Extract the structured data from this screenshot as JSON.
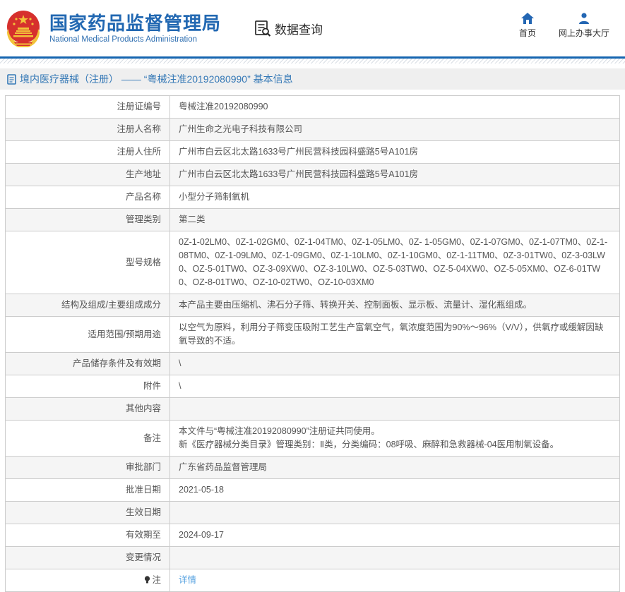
{
  "header": {
    "brand_title": "国家药品监督管理局",
    "brand_subtitle": "National Medical Products Administration",
    "data_query_label": "数据查询",
    "nav": [
      {
        "label": "首页",
        "icon": "home-icon"
      },
      {
        "label": "网上办事大厅",
        "icon": "user-icon"
      }
    ]
  },
  "colors": {
    "brand_blue": "#2268b2",
    "rule_blue": "#1565b0",
    "title_blue": "#3478b6",
    "link_blue": "#55a1e0",
    "emblem_red": "#d6302d",
    "emblem_gold": "#f2c239",
    "row_stripe": "#f5f5f5",
    "border_gray": "#cccccc"
  },
  "page_title": "境内医疗器械（注册） —— “粤械注准20192080990” 基本信息",
  "table": {
    "rows": [
      {
        "label": "注册证编号",
        "value": "粤械注准20192080990"
      },
      {
        "label": "注册人名称",
        "value": "广州生命之光电子科技有限公司"
      },
      {
        "label": "注册人住所",
        "value": "广州市白云区北太路1633号广州民营科技园科盛路5号A101房"
      },
      {
        "label": "生产地址",
        "value": "广州市白云区北太路1633号广州民营科技园科盛路5号A101房"
      },
      {
        "label": "产品名称",
        "value": "小型分子筛制氧机"
      },
      {
        "label": "管理类别",
        "value": "第二类"
      },
      {
        "label": "型号规格",
        "value": "0Z-1-02LM0、0Z-1-02GM0、0Z-1-04TM0、0Z-1-05LM0、0Z- 1-05GM0、0Z-1-07GM0、0Z-1-07TM0、0Z-1-08TM0、0Z-1-09LM0、0Z-1-09GM0、0Z-1-10LM0、0Z-1-10GM0、0Z-1-11TM0、0Z-3-01TW0、0Z-3-03LW0、OZ-5-01TW0、OZ-3-09XW0、OZ-3-10LW0、OZ-5-03TW0、OZ-5-04XW0、OZ-5-05XM0、OZ-6-01TW0、OZ-8-01TW0、OZ-10-02TW0、OZ-10-03XM0"
      },
      {
        "label": "结构及组成/主要组成成分",
        "value": "本产品主要由压缩机、沸石分子筛、转换开关、控制面板、显示板、流量计、湿化瓶组成。"
      },
      {
        "label": "适用范围/预期用途",
        "value": "以空气为原料，利用分子筛变压吸附工艺生产富氧空气，氧浓度范围为90%～96%（V/V），供氧疗或缓解因缺氧导致的不适。"
      },
      {
        "label": "产品储存条件及有效期",
        "value": "\\"
      },
      {
        "label": "附件",
        "value": "\\"
      },
      {
        "label": "其他内容",
        "value": ""
      },
      {
        "label": "备注",
        "lines": [
          "本文件与“粤械注准20192080990”注册证共同使用。",
          "新《医疗器械分类目录》管理类别：Ⅱ类，分类编码：08呼吸、麻醉和急救器械-04医用制氧设备。"
        ]
      },
      {
        "label": "审批部门",
        "value": "广东省药品监督管理局"
      },
      {
        "label": "批准日期",
        "value": "2021-05-18"
      },
      {
        "label": "生效日期",
        "value": ""
      },
      {
        "label": "有效期至",
        "value": "2024-09-17"
      },
      {
        "label": "变更情况",
        "value": ""
      },
      {
        "label": "注",
        "label_icon": "bulb-icon",
        "link": "详情"
      }
    ]
  }
}
